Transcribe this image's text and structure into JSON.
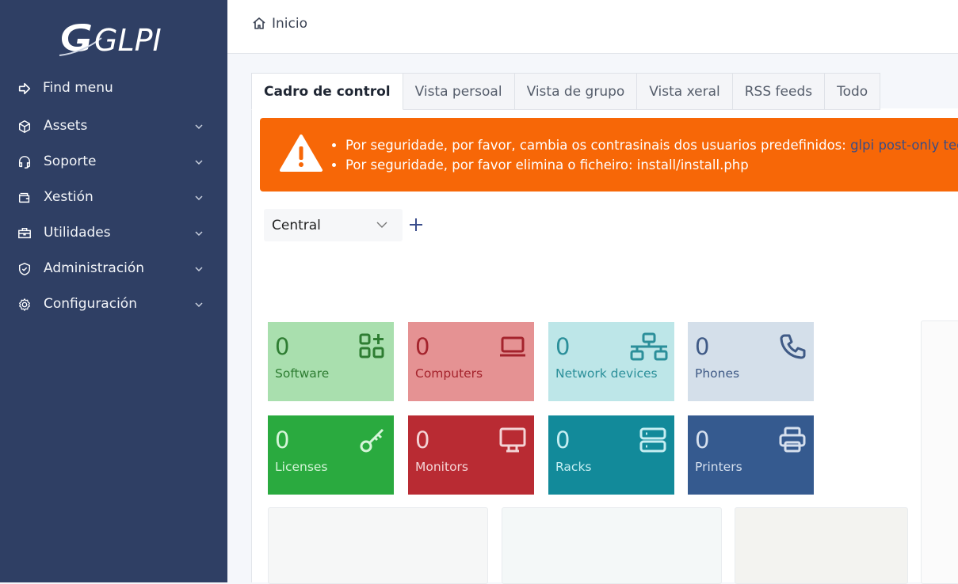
{
  "sidebar": {
    "logo_text": "GLPI",
    "items": [
      {
        "label": "Find menu",
        "icon": "arrow-right-to-bracket-icon",
        "has_chevron": false
      },
      {
        "label": "Assets",
        "icon": "cube-icon",
        "has_chevron": true
      },
      {
        "label": "Soporte",
        "icon": "headset-icon",
        "has_chevron": true
      },
      {
        "label": "Xestión",
        "icon": "wallet-icon",
        "has_chevron": true
      },
      {
        "label": "Utilidades",
        "icon": "briefcase-icon",
        "has_chevron": true
      },
      {
        "label": "Administración",
        "icon": "shield-check-icon",
        "has_chevron": true
      },
      {
        "label": "Configuración",
        "icon": "gear-icon",
        "has_chevron": true
      }
    ]
  },
  "header": {
    "breadcrumb": "Inicio"
  },
  "tabs": [
    "Cadro de control",
    "Vista persoal",
    "Vista de grupo",
    "Vista xeral",
    "RSS feeds",
    "Todo"
  ],
  "alert": {
    "line1_text": "Por seguridade, por favor, cambia os contrasinais dos usuarios predefinidos: ",
    "line1_link": "glpi post-only tech",
    "line2_text": "Por seguridade, por favor elimina o ficheiro: install/install.php"
  },
  "dashboard": {
    "selected": "Central"
  },
  "cards": [
    {
      "value": "0",
      "label": "Software",
      "icon": "apps-add-icon",
      "bg": "#a9dfae",
      "fg": "#2e7d32"
    },
    {
      "value": "0",
      "label": "Computers",
      "icon": "laptop-icon",
      "bg": "#e59293",
      "fg": "#a4232c"
    },
    {
      "value": "0",
      "label": "Network devices",
      "icon": "network-icon",
      "bg": "#bde6e8",
      "fg": "#2b8f9a"
    },
    {
      "value": "0",
      "label": "Phones",
      "icon": "phone-icon",
      "bg": "#d4dfea",
      "fg": "#3f5a86"
    },
    {
      "value": "0",
      "label": "Licenses",
      "icon": "key-icon",
      "bg": "#2aaa3f",
      "fg": "#d6f5d9"
    },
    {
      "value": "0",
      "label": "Monitors",
      "icon": "monitor-icon",
      "bg": "#b92b33",
      "fg": "#f4d4d6"
    },
    {
      "value": "0",
      "label": "Racks",
      "icon": "server-icon",
      "bg": "#128a9a",
      "fg": "#c6eef2"
    },
    {
      "value": "0",
      "label": "Printers",
      "icon": "printer-icon",
      "bg": "#355a8f",
      "fg": "#d6e0ee"
    }
  ]
}
